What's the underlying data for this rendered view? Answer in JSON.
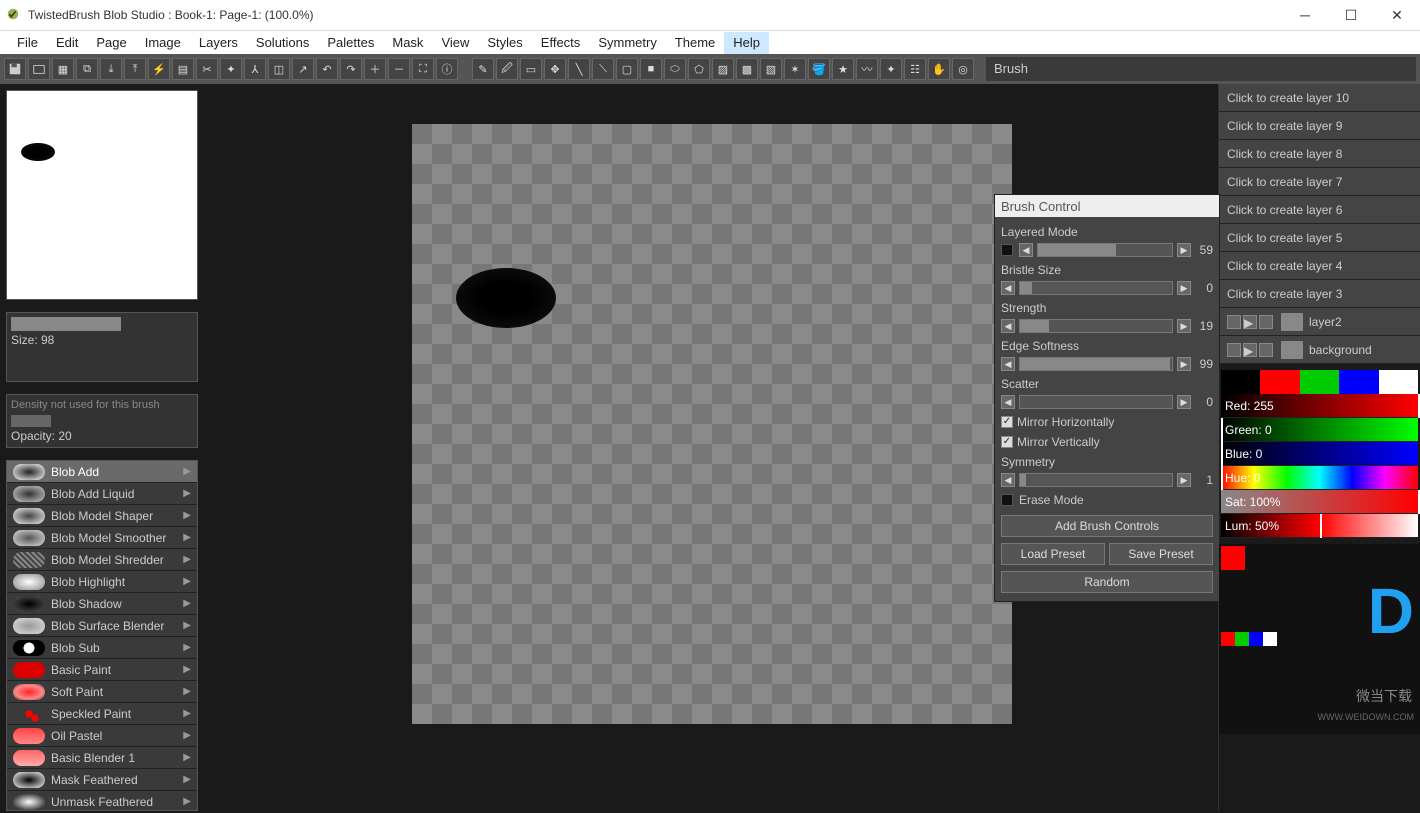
{
  "title": "TwistedBrush Blob Studio : Book-1: Page-1:  (100.0%)",
  "menu": [
    "File",
    "Edit",
    "Page",
    "Image",
    "Layers",
    "Solutions",
    "Palettes",
    "Mask",
    "View",
    "Styles",
    "Effects",
    "Symmetry",
    "Theme",
    "Help"
  ],
  "menu_hl": "Help",
  "toolbar_label": "Brush",
  "size_label": "Size: 98",
  "density_text": "Density not used for this brush",
  "opacity_label": "Opacity: 20",
  "brushes": [
    {
      "name": "Blob Add",
      "sel": true,
      "sw": "radial-gradient(ellipse,#222,#fff)"
    },
    {
      "name": "Blob Add Liquid",
      "sw": "radial-gradient(ellipse,#333,#ccc)"
    },
    {
      "name": "Blob Model Shaper",
      "sw": "radial-gradient(ellipse,#444,#eee)"
    },
    {
      "name": "Blob Model Smoother",
      "sw": "radial-gradient(ellipse,#555,#ddd)"
    },
    {
      "name": "Blob Model Shredder",
      "sw": "repeating-linear-gradient(45deg,#888 0 2px,#444 2px 4px)"
    },
    {
      "name": "Blob Highlight",
      "sw": "radial-gradient(ellipse,#fff,#888)"
    },
    {
      "name": "Blob Shadow",
      "sw": "radial-gradient(ellipse,#000,#555)"
    },
    {
      "name": "Blob Surface Blender",
      "sw": "radial-gradient(ellipse,#999,#ddd)"
    },
    {
      "name": "Blob Sub",
      "sw": "radial-gradient(circle,#fff 30%,#000 31%)"
    },
    {
      "name": "Basic Paint",
      "sw": "linear-gradient(#d00,#d00)"
    },
    {
      "name": "Soft Paint",
      "sw": "radial-gradient(ellipse,#f22,#f88 60%,transparent)"
    },
    {
      "name": "Speckled Paint",
      "sw": "radial-gradient(circle,#f00 20%,transparent 21%),radial-gradient(circle,#f00 20%,transparent 21%) 6px 4px"
    },
    {
      "name": "Oil Pastel",
      "sw": "linear-gradient(#f44,#f88)"
    },
    {
      "name": "Basic Blender 1",
      "sw": "linear-gradient(#f66,#faa)"
    },
    {
      "name": "Mask Feathered",
      "sw": "radial-gradient(ellipse,#000,#fff)"
    },
    {
      "name": "Unmask Feathered",
      "sw": "radial-gradient(ellipse,#fff,#000)"
    }
  ],
  "layers_clickable": [
    "Click to create layer 10",
    "Click to create layer 9",
    "Click to create layer 8",
    "Click to create layer 7",
    "Click to create layer 6",
    "Click to create layer 5",
    "Click to create layer 4",
    "Click to create layer 3"
  ],
  "layer_active": "layer2",
  "layer_bg": "background",
  "color_palette": [
    [
      "#000",
      "#f00",
      "#0c0",
      "#00f",
      "#fff"
    ]
  ],
  "color_sliders": [
    {
      "label": "Red: 255",
      "bg": "linear-gradient(90deg,#000,#f00)",
      "mark": "100%"
    },
    {
      "label": "Green: 0",
      "bg": "linear-gradient(90deg,#000,#0f0)",
      "mark": "0%"
    },
    {
      "label": "Blue: 0",
      "bg": "linear-gradient(90deg,#000,#00f)",
      "mark": "0%"
    },
    {
      "label": "Hue: 0",
      "bg": "linear-gradient(90deg,#f00,#ff0,#0f0,#0ff,#00f,#f0f,#f00)",
      "mark": "0%"
    },
    {
      "label": "Sat: 100%",
      "bg": "linear-gradient(90deg,#888,#f00)",
      "mark": "100%"
    },
    {
      "label": "Lum: 50%",
      "bg": "linear-gradient(90deg,#000,#f00,#fff)",
      "mark": "50%"
    }
  ],
  "brush_control": {
    "title": "Brush Control",
    "sliders": [
      {
        "label": "Layered Mode",
        "val": 59,
        "fill": 58,
        "lead": true
      },
      {
        "label": "Bristle Size",
        "val": 0,
        "fill": 8
      },
      {
        "label": "Strength",
        "val": 19,
        "fill": 19
      },
      {
        "label": "Edge Softness",
        "val": 99,
        "fill": 99
      },
      {
        "label": "Scatter",
        "val": 0,
        "fill": 0
      }
    ],
    "checks": [
      {
        "label": "Mirror Horizontally",
        "checked": true
      },
      {
        "label": "Mirror Vertically",
        "checked": true
      }
    ],
    "sym": {
      "label": "Symmetry",
      "val": 1,
      "fill": 4
    },
    "erase": {
      "label": "Erase Mode",
      "checked": false
    },
    "btn_add": "Add Brush Controls",
    "btn_load": "Load Preset",
    "btn_save": "Save Preset",
    "btn_rand": "Random"
  },
  "watermark": "微当下载",
  "watermark_url": "WWW.WEIDOWN.COM"
}
